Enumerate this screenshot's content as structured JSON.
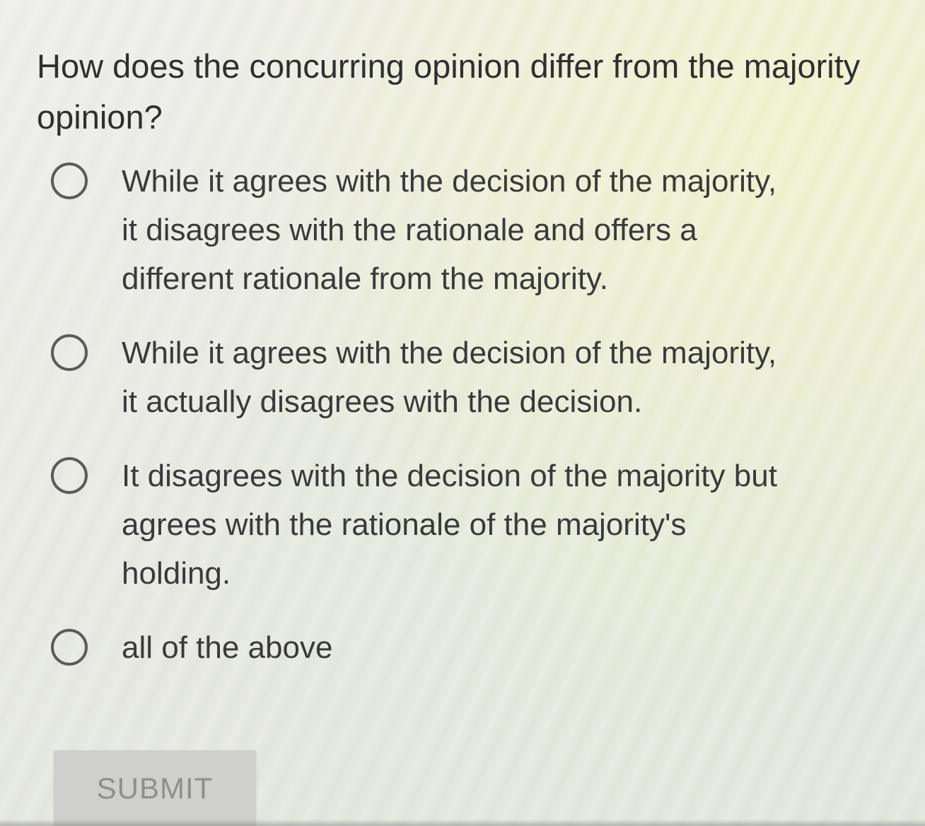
{
  "question": {
    "text": "How does the concurring opinion differ from the majority opinion?"
  },
  "options": [
    {
      "label": "While it agrees with the decision of the majority, it disagrees with the rationale and offers a different rationale from the majority.",
      "selected": false
    },
    {
      "label": "While it agrees with the decision of the majority, it actually disagrees with the decision.",
      "selected": false
    },
    {
      "label": "It disagrees with the decision of the majority but agrees with the rationale of the majority's holding.",
      "selected": false
    },
    {
      "label": "all of the above",
      "selected": false
    }
  ],
  "submit": {
    "label": "SUBMIT",
    "disabled": true
  },
  "colors": {
    "text": "#3a3a3a",
    "radio_border": "#5b5b5b",
    "submit_bg": "#cfcfcd",
    "submit_text": "#8f8f8f"
  }
}
